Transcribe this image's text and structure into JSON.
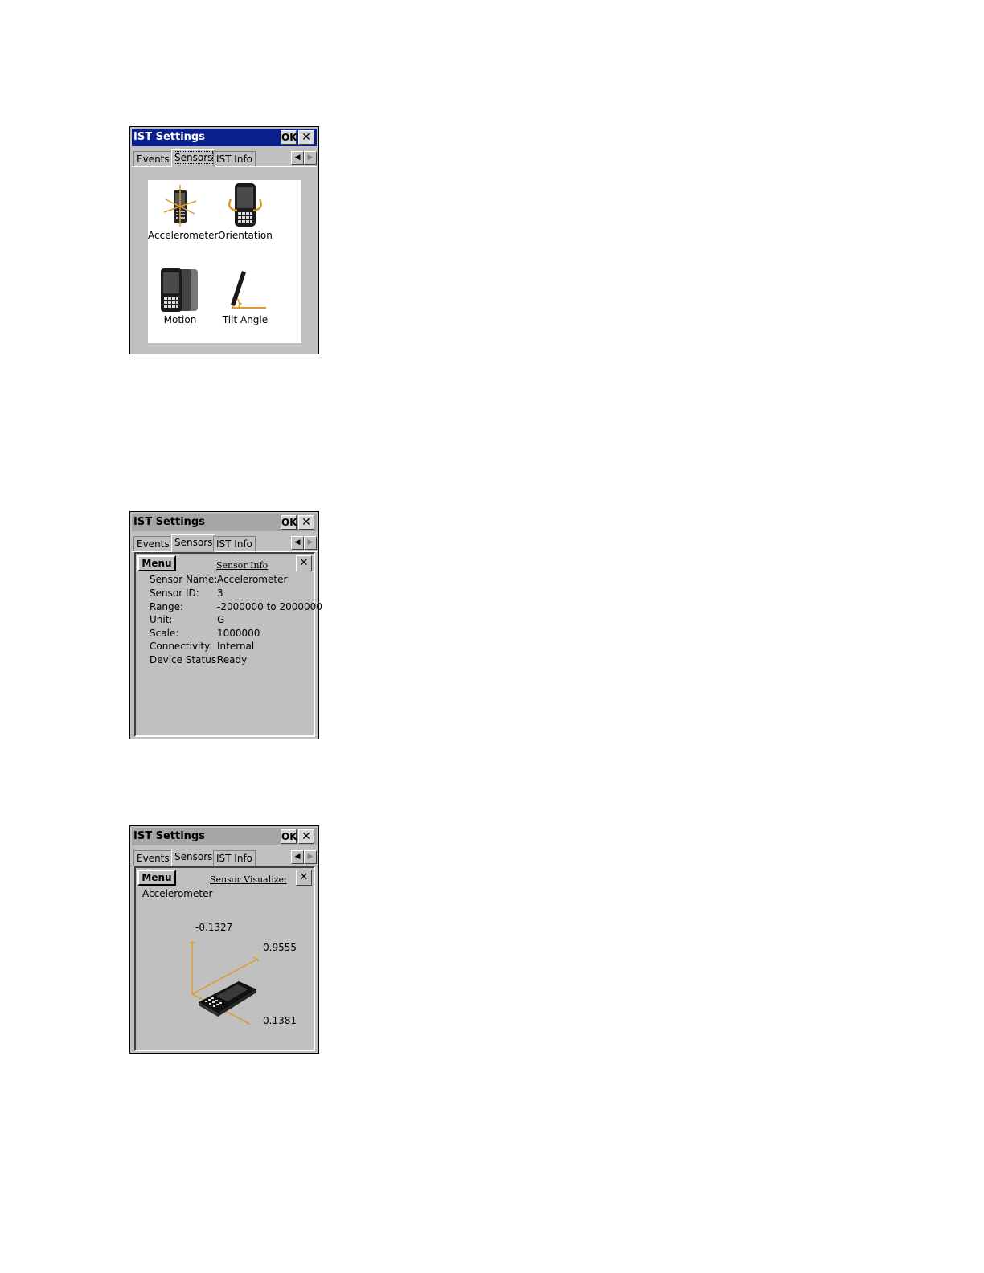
{
  "windows": [
    {
      "title": "IST Settings",
      "ok_label": "OK",
      "close_label": "✕",
      "tabs": [
        "Events",
        "Sensors",
        "IST Info"
      ],
      "selected_tab": "Sensors",
      "icons": [
        {
          "label": "Accelerometer",
          "icon": "accelerometer-icon"
        },
        {
          "label": "Orientation",
          "icon": "orientation-icon"
        },
        {
          "label": "Motion",
          "icon": "motion-icon"
        },
        {
          "label": "Tilt Angle",
          "icon": "tilt-angle-icon"
        }
      ]
    },
    {
      "title": "IST Settings",
      "ok_label": "OK",
      "close_label": "✕",
      "tabs": [
        "Events",
        "Sensors",
        "IST Info"
      ],
      "menu_label": "Menu",
      "panel_close_label": "✕",
      "heading": "Sensor Info",
      "rows": [
        {
          "key": "Sensor Name:",
          "value": "Accelerometer"
        },
        {
          "key": "Sensor ID:",
          "value": "3"
        },
        {
          "key": "Range:",
          "value": "-2000000 to 2000000"
        },
        {
          "key": "Unit:",
          "value": "G"
        },
        {
          "key": "Scale:",
          "value": "1000000"
        },
        {
          "key": "Connectivity:",
          "value": "Internal"
        },
        {
          "key": "Device Status:",
          "value": "Ready"
        }
      ]
    },
    {
      "title": "IST Settings",
      "ok_label": "OK",
      "close_label": "✕",
      "tabs": [
        "Events",
        "Sensors",
        "IST Info"
      ],
      "menu_label": "Menu",
      "panel_close_label": "✕",
      "heading": "Sensor Visualize:",
      "sensor": "Accelerometer",
      "values": {
        "z": "-0.1327",
        "y": "0.9555",
        "x": "0.1381"
      }
    }
  ],
  "colors": {
    "active_title": "#0a1e8c",
    "axis_orange": "#e09a2a",
    "window_gray": "#c0c0c0"
  }
}
